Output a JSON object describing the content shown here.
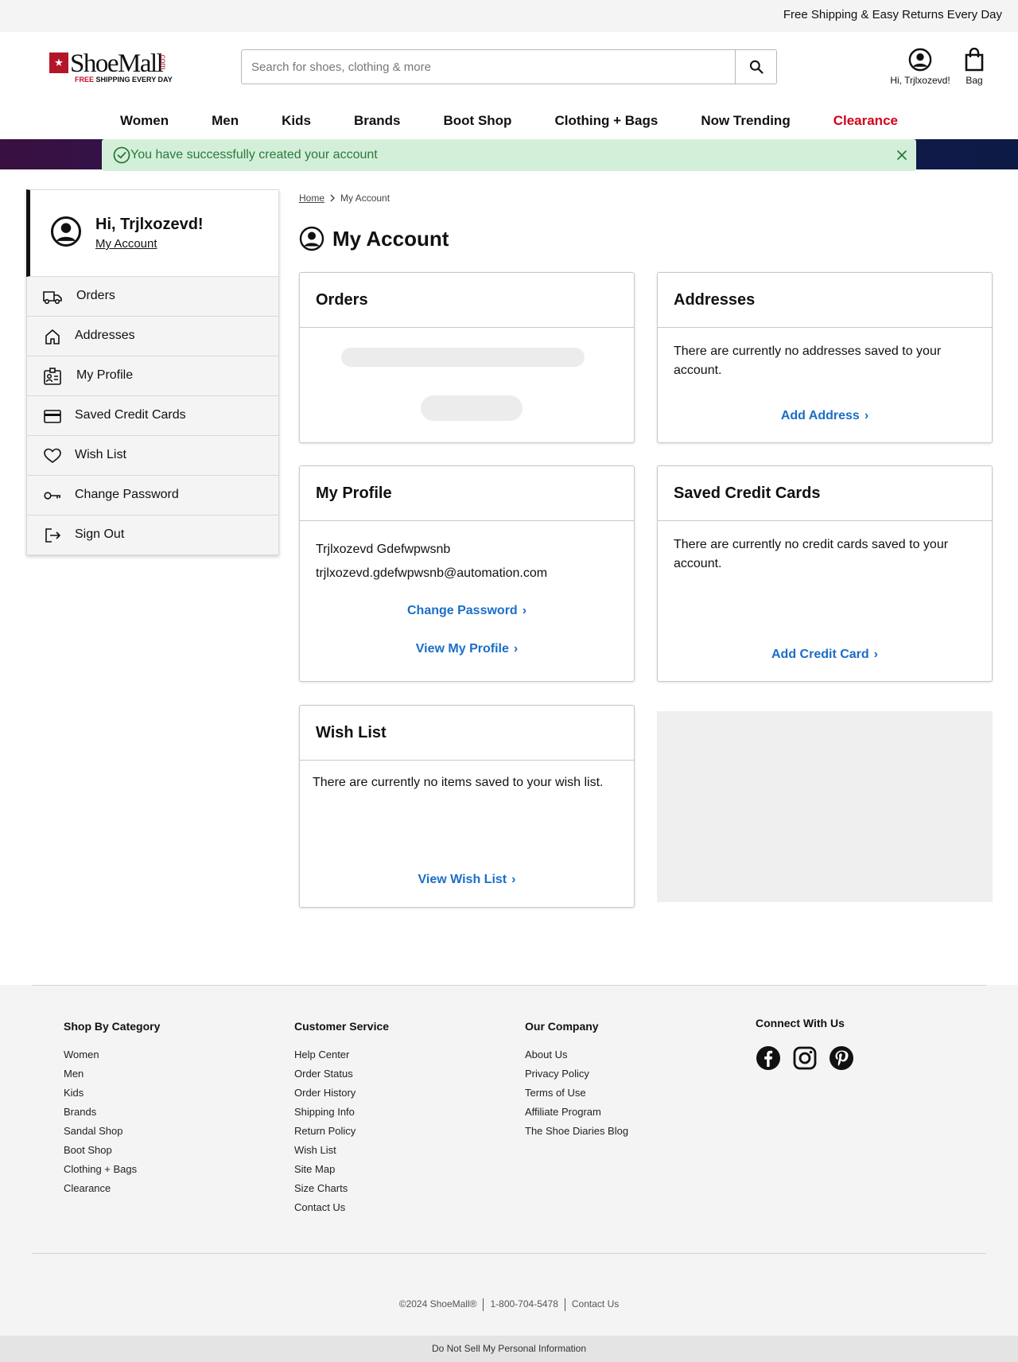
{
  "promo": {
    "text": "Free Shipping & Easy Returns Every Day"
  },
  "logo": {
    "mark": "★",
    "word": "ShoeMall",
    "com": ".com",
    "tag_strong": "FREE",
    "tag_rest": " SHIPPING EVERY DAY"
  },
  "search": {
    "placeholder": "Search for shoes, clothing & more",
    "value": ""
  },
  "header": {
    "account_label": "Hi, Trjlxozevd!",
    "bag_label": "Bag"
  },
  "nav": [
    "Women",
    "Men",
    "Kids",
    "Brands",
    "Boot Shop",
    "Clothing + Bags",
    "Now Trending",
    "Clearance"
  ],
  "alert": {
    "message": "You have successfully created your account"
  },
  "sidebar": {
    "greeting": "Hi, Trjlxozevd!",
    "my_account": "My Account",
    "items": [
      "Orders",
      "Addresses",
      "My Profile",
      "Saved Credit Cards",
      "Wish List",
      "Change Password",
      "Sign Out"
    ]
  },
  "breadcrumb": {
    "home": "Home",
    "current": "My Account"
  },
  "page": {
    "title": "My Account"
  },
  "cards": {
    "orders": {
      "title": "Orders"
    },
    "addresses": {
      "title": "Addresses",
      "text": "There are currently no addresses saved to your account.",
      "action": "Add Address"
    },
    "profile": {
      "title": "My Profile",
      "name": "Trjlxozevd Gdefwpwsnb",
      "email": "trjlxozevd.gdefwpwsnb@automation.com",
      "action1": "Change Password",
      "action2": "View My Profile"
    },
    "cards": {
      "title": "Saved Credit Cards",
      "text": "There are currently no credit cards saved to your account.",
      "action": "Add Credit Card"
    },
    "wishlist": {
      "title": "Wish List",
      "text": "There are currently no items saved to your wish list.",
      "action": "View Wish List"
    }
  },
  "footer": {
    "shop": {
      "title": "Shop By Category",
      "links": [
        "Women",
        "Men",
        "Kids",
        "Brands",
        "Sandal Shop",
        "Boot Shop",
        "Clothing + Bags",
        "Clearance"
      ]
    },
    "service": {
      "title": "Customer Service",
      "links": [
        "Help Center",
        "Order Status",
        "Order History",
        "Shipping Info",
        "Return Policy",
        "Wish List",
        "Site Map",
        "Size Charts",
        "Contact Us"
      ]
    },
    "company": {
      "title": "Our Company",
      "links": [
        "About Us",
        "Privacy Policy",
        "Terms of Use",
        "Affiliate Program",
        "The Shoe Diaries Blog"
      ]
    },
    "connect": {
      "title": "Connect With Us",
      "icons": [
        "facebook-icon",
        "instagram-icon",
        "pinterest-icon"
      ]
    },
    "copyright": "©2024 ShoeMall®",
    "phone": "1-800-704-5478",
    "contact": "Contact Us",
    "dns": "Do Not Sell My Personal Information"
  },
  "colors": {
    "link_blue": "#1a6ec8",
    "clearance_red": "#d0021b",
    "success_green": "#2b7a3c",
    "success_bg": "#d4efd9",
    "brand_red": "#b3162b"
  }
}
